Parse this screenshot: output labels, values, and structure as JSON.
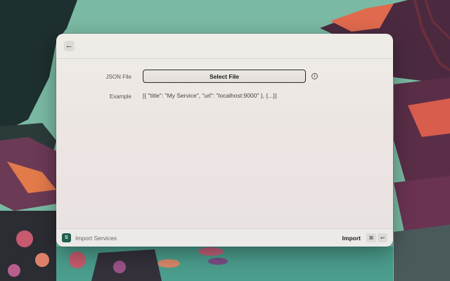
{
  "window": {
    "back_icon": "arrow-left-icon"
  },
  "form": {
    "json_file_label": "JSON File",
    "select_file_label": "Select File",
    "info_icon": "info-icon",
    "example_label": "Example",
    "example_value": "[{ \"title\": \"My Service\", \"url\": \"localhost:9000\" }, {...}]"
  },
  "footer": {
    "app_title": "Import Services",
    "action_label": "Import",
    "shortcut_cmd": "⌘",
    "shortcut_enter": "↩"
  },
  "colors": {
    "accent_border": "#2b2b2b",
    "app_icon_bg": "#1f5e4f"
  }
}
